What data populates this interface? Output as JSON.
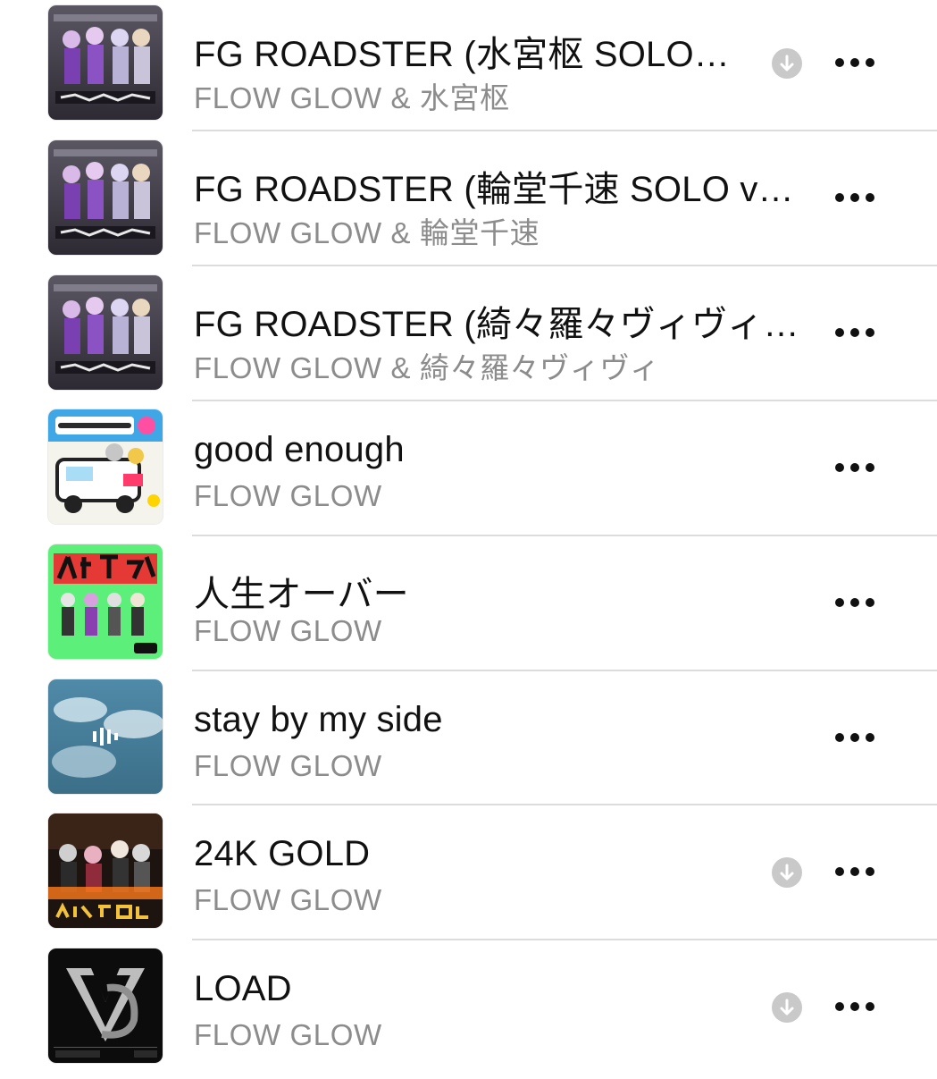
{
  "tracks": [
    {
      "title": "FG ROADSTER (水宮枢 SOLO…",
      "artist": "FLOW GLOW & 水宮枢",
      "downloaded": true,
      "art": "roadster"
    },
    {
      "title": "FG ROADSTER (輪堂千速 SOLO v…",
      "artist": "FLOW GLOW & 輪堂千速",
      "downloaded": false,
      "art": "roadster"
    },
    {
      "title": "FG ROADSTER (綺々羅々ヴィヴィ…",
      "artist": "FLOW GLOW & 綺々羅々ヴィヴィ",
      "downloaded": false,
      "art": "roadster"
    },
    {
      "title": "good enough",
      "artist": "FLOW GLOW",
      "downloaded": false,
      "art": "good-enough"
    },
    {
      "title": "人生オーバー",
      "artist": "FLOW GLOW",
      "downloaded": false,
      "art": "jinsei-over"
    },
    {
      "title": "stay by my side",
      "artist": "FLOW GLOW",
      "downloaded": false,
      "art": "stay-by-my-side"
    },
    {
      "title": "24K GOLD",
      "artist": "FLOW GLOW",
      "downloaded": true,
      "art": "24k-gold"
    },
    {
      "title": "LOAD",
      "artist": "FLOW GLOW",
      "downloaded": true,
      "art": "load"
    }
  ],
  "icons": {
    "download": "arrow-down-circle-icon",
    "more": "ellipsis-icon"
  },
  "colors": {
    "title": "#111111",
    "subtitle": "#8c8c8c",
    "separator": "#dcdcdc",
    "download_badge": "#c9c9c9"
  }
}
